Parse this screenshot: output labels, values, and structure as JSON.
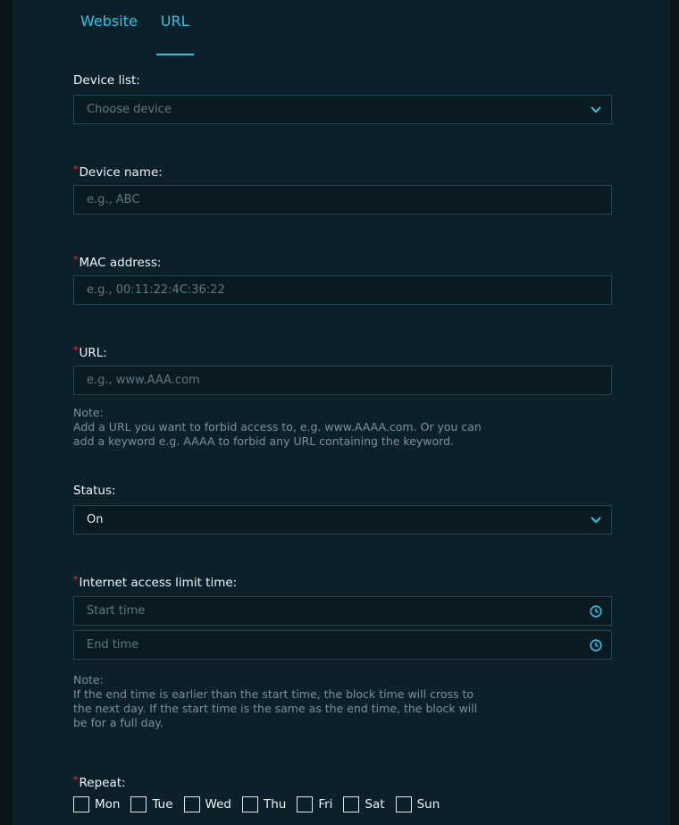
{
  "tabs": [
    {
      "label": "Website",
      "active": false
    },
    {
      "label": "URL",
      "active": true
    }
  ],
  "device_list": {
    "label": "Device list:",
    "placeholder": "Choose device"
  },
  "device_name": {
    "label": "Device name:",
    "placeholder": "e.g., ABC",
    "required": true
  },
  "mac_address": {
    "label": "MAC address:",
    "placeholder": "e.g., 00:11:22:4C:36:22",
    "required": true
  },
  "url": {
    "label": "URL:",
    "placeholder": "e.g., www.AAA.com",
    "required": true
  },
  "url_note": {
    "title": "Note:",
    "line1": "Add a URL you want to forbid access to, e.g. www.AAAA.com. Or you can",
    "line2": "add a keyword e.g. AAAA to forbid any URL containing the keyword."
  },
  "status": {
    "label": "Status:",
    "value": "On"
  },
  "limit_time": {
    "label": "Internet access limit time:",
    "required": true,
    "start_placeholder": "Start time",
    "end_placeholder": "End time"
  },
  "time_note": {
    "title": "Note:",
    "line1": "If the end time is earlier than the start time, the block time will cross to",
    "line2": "the next day. If the start time is the same as the end time, the block will",
    "line3": "be for a full day."
  },
  "repeat": {
    "label": "Repeat:",
    "required": true,
    "days": [
      {
        "label": "Mon",
        "checked": false
      },
      {
        "label": "Tue",
        "checked": false
      },
      {
        "label": "Wed",
        "checked": false
      },
      {
        "label": "Thu",
        "checked": false
      },
      {
        "label": "Fri",
        "checked": false
      },
      {
        "label": "Sat",
        "checked": false
      },
      {
        "label": "Sun",
        "checked": false
      }
    ]
  },
  "colors": {
    "accent": "#2ec5e6",
    "required": "#e23b3b",
    "panel": "#0b2029"
  },
  "icons": {
    "select": "chevron-down-icon",
    "time": "clock-icon"
  }
}
